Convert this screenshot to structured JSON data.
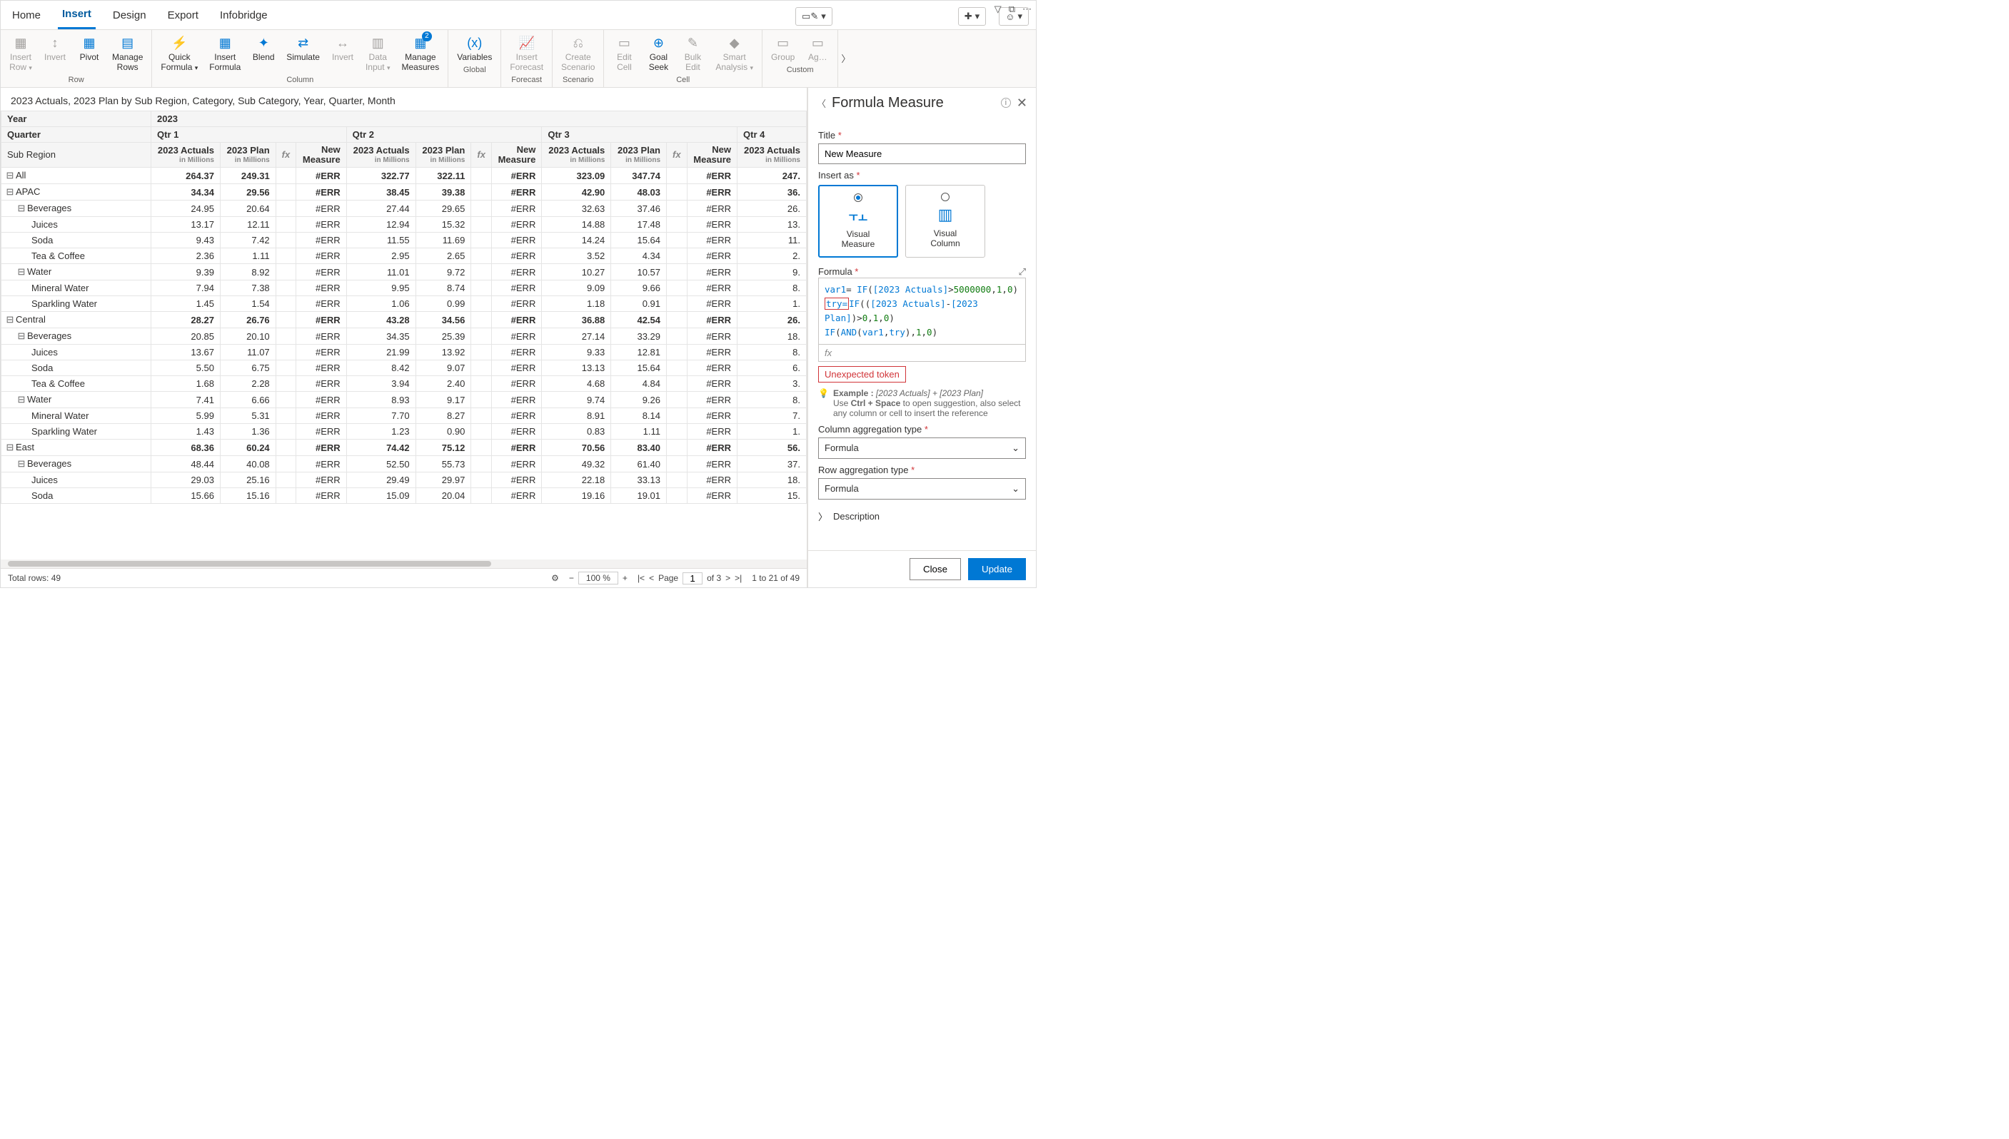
{
  "tabs": [
    "Home",
    "Insert",
    "Design",
    "Export",
    "Infobridge"
  ],
  "active_tab": 1,
  "ribbon": {
    "groups": [
      {
        "label": "Row",
        "buttons": [
          {
            "label": "Insert\nRow",
            "chev": true,
            "disabled": true,
            "icon": "▦"
          },
          {
            "label": "Invert",
            "disabled": true,
            "icon": "↕"
          },
          {
            "label": "Pivot",
            "icon": "▦"
          },
          {
            "label": "Manage\nRows",
            "icon": "▤"
          }
        ]
      },
      {
        "label": "Column",
        "buttons": [
          {
            "label": "Quick\nFormula",
            "chev": true,
            "icon": "⚡"
          },
          {
            "label": "Insert\nFormula",
            "icon": "▦"
          },
          {
            "label": "Blend",
            "icon": "✦"
          },
          {
            "label": "Simulate",
            "icon": "⇄"
          },
          {
            "label": "Invert",
            "disabled": true,
            "icon": "↔"
          },
          {
            "label": "Data\nInput",
            "chev": true,
            "disabled": true,
            "icon": "▥"
          },
          {
            "label": "Manage\nMeasures",
            "icon": "▦",
            "badge": "2"
          }
        ]
      },
      {
        "label": "Global",
        "buttons": [
          {
            "label": "Variables",
            "icon": "(x)"
          }
        ]
      },
      {
        "label": "Forecast",
        "buttons": [
          {
            "label": "Insert\nForecast",
            "disabled": true,
            "icon": "📈"
          }
        ]
      },
      {
        "label": "Scenario",
        "buttons": [
          {
            "label": "Create\nScenario",
            "disabled": true,
            "icon": "⎌"
          }
        ]
      },
      {
        "label": "Cell",
        "buttons": [
          {
            "label": "Edit\nCell",
            "disabled": true,
            "icon": "▭"
          },
          {
            "label": "Goal\nSeek",
            "icon": "⊕"
          },
          {
            "label": "Bulk\nEdit",
            "disabled": true,
            "icon": "✎"
          },
          {
            "label": "Smart\nAnalysis",
            "chev": true,
            "disabled": true,
            "icon": "◆"
          }
        ]
      },
      {
        "label": "Custom",
        "buttons": [
          {
            "label": "Group",
            "disabled": true,
            "icon": "▭"
          },
          {
            "label": "Ag…",
            "disabled": true,
            "icon": "▭"
          }
        ]
      }
    ]
  },
  "grid_title": "2023 Actuals, 2023 Plan by Sub Region, Category, Sub Category, Year, Quarter, Month",
  "dim_headers": {
    "year": "Year",
    "quarter": "Quarter",
    "subregion": "Sub Region"
  },
  "year_value": "2023",
  "quarters": [
    "Qtr 1",
    "Qtr 2",
    "Qtr 3",
    "Qtr 4"
  ],
  "col_set": [
    {
      "label": "2023 Actuals",
      "sub": "in Millions"
    },
    {
      "label": "2023 Plan",
      "sub": "in Millions"
    },
    {
      "fx": true
    },
    {
      "label": "New\nMeasure"
    }
  ],
  "rows": [
    {
      "l": "All",
      "d": 0,
      "b": true,
      "e": "-",
      "v": [
        "264.37",
        "249.31",
        "#ERR",
        "322.77",
        "322.11",
        "#ERR",
        "323.09",
        "347.74",
        "#ERR",
        "247."
      ]
    },
    {
      "l": "APAC",
      "d": 0,
      "b": true,
      "e": "-",
      "v": [
        "34.34",
        "29.56",
        "#ERR",
        "38.45",
        "39.38",
        "#ERR",
        "42.90",
        "48.03",
        "#ERR",
        "36."
      ]
    },
    {
      "l": "Beverages",
      "d": 1,
      "e": "-",
      "v": [
        "24.95",
        "20.64",
        "#ERR",
        "27.44",
        "29.65",
        "#ERR",
        "32.63",
        "37.46",
        "#ERR",
        "26."
      ]
    },
    {
      "l": "Juices",
      "d": 2,
      "v": [
        "13.17",
        "12.11",
        "#ERR",
        "12.94",
        "15.32",
        "#ERR",
        "14.88",
        "17.48",
        "#ERR",
        "13."
      ]
    },
    {
      "l": "Soda",
      "d": 2,
      "v": [
        "9.43",
        "7.42",
        "#ERR",
        "11.55",
        "11.69",
        "#ERR",
        "14.24",
        "15.64",
        "#ERR",
        "11."
      ]
    },
    {
      "l": "Tea & Coffee",
      "d": 2,
      "v": [
        "2.36",
        "1.11",
        "#ERR",
        "2.95",
        "2.65",
        "#ERR",
        "3.52",
        "4.34",
        "#ERR",
        "2."
      ]
    },
    {
      "l": "Water",
      "d": 1,
      "e": "-",
      "v": [
        "9.39",
        "8.92",
        "#ERR",
        "11.01",
        "9.72",
        "#ERR",
        "10.27",
        "10.57",
        "#ERR",
        "9."
      ]
    },
    {
      "l": "Mineral Water",
      "d": 2,
      "v": [
        "7.94",
        "7.38",
        "#ERR",
        "9.95",
        "8.74",
        "#ERR",
        "9.09",
        "9.66",
        "#ERR",
        "8."
      ]
    },
    {
      "l": "Sparkling Water",
      "d": 2,
      "v": [
        "1.45",
        "1.54",
        "#ERR",
        "1.06",
        "0.99",
        "#ERR",
        "1.18",
        "0.91",
        "#ERR",
        "1."
      ]
    },
    {
      "l": "Central",
      "d": 0,
      "b": true,
      "e": "-",
      "v": [
        "28.27",
        "26.76",
        "#ERR",
        "43.28",
        "34.56",
        "#ERR",
        "36.88",
        "42.54",
        "#ERR",
        "26."
      ]
    },
    {
      "l": "Beverages",
      "d": 1,
      "e": "-",
      "v": [
        "20.85",
        "20.10",
        "#ERR",
        "34.35",
        "25.39",
        "#ERR",
        "27.14",
        "33.29",
        "#ERR",
        "18."
      ]
    },
    {
      "l": "Juices",
      "d": 2,
      "v": [
        "13.67",
        "11.07",
        "#ERR",
        "21.99",
        "13.92",
        "#ERR",
        "9.33",
        "12.81",
        "#ERR",
        "8."
      ]
    },
    {
      "l": "Soda",
      "d": 2,
      "v": [
        "5.50",
        "6.75",
        "#ERR",
        "8.42",
        "9.07",
        "#ERR",
        "13.13",
        "15.64",
        "#ERR",
        "6."
      ]
    },
    {
      "l": "Tea & Coffee",
      "d": 2,
      "v": [
        "1.68",
        "2.28",
        "#ERR",
        "3.94",
        "2.40",
        "#ERR",
        "4.68",
        "4.84",
        "#ERR",
        "3."
      ]
    },
    {
      "l": "Water",
      "d": 1,
      "e": "-",
      "v": [
        "7.41",
        "6.66",
        "#ERR",
        "8.93",
        "9.17",
        "#ERR",
        "9.74",
        "9.26",
        "#ERR",
        "8."
      ]
    },
    {
      "l": "Mineral Water",
      "d": 2,
      "v": [
        "5.99",
        "5.31",
        "#ERR",
        "7.70",
        "8.27",
        "#ERR",
        "8.91",
        "8.14",
        "#ERR",
        "7."
      ]
    },
    {
      "l": "Sparkling Water",
      "d": 2,
      "v": [
        "1.43",
        "1.36",
        "#ERR",
        "1.23",
        "0.90",
        "#ERR",
        "0.83",
        "1.11",
        "#ERR",
        "1."
      ]
    },
    {
      "l": "East",
      "d": 0,
      "b": true,
      "e": "-",
      "v": [
        "68.36",
        "60.24",
        "#ERR",
        "74.42",
        "75.12",
        "#ERR",
        "70.56",
        "83.40",
        "#ERR",
        "56."
      ]
    },
    {
      "l": "Beverages",
      "d": 1,
      "e": "-",
      "v": [
        "48.44",
        "40.08",
        "#ERR",
        "52.50",
        "55.73",
        "#ERR",
        "49.32",
        "61.40",
        "#ERR",
        "37."
      ]
    },
    {
      "l": "Juices",
      "d": 2,
      "v": [
        "29.03",
        "25.16",
        "#ERR",
        "29.49",
        "29.97",
        "#ERR",
        "22.18",
        "33.13",
        "#ERR",
        "18."
      ]
    },
    {
      "l": "Soda",
      "d": 2,
      "v": [
        "15.66",
        "15.16",
        "#ERR",
        "15.09",
        "20.04",
        "#ERR",
        "19.16",
        "19.01",
        "#ERR",
        "15."
      ]
    }
  ],
  "footer": {
    "total_rows_label": "Total rows:",
    "total_rows": "49",
    "zoom": "100 %",
    "page_label": "Page",
    "page": "1",
    "of": "of 3",
    "range": "1  to  21  of  49"
  },
  "panel": {
    "title": "Formula Measure",
    "title_label": "Title",
    "title_value": "New Measure",
    "insert_as_label": "Insert as",
    "ias": [
      {
        "label": "Visual\nMeasure",
        "selected": true
      },
      {
        "label": "Visual\nColumn",
        "selected": false
      }
    ],
    "formula_label": "Formula",
    "formula_lines": [
      [
        {
          "t": "var1",
          "c": "var"
        },
        {
          "t": "= "
        },
        {
          "t": "IF",
          "c": "fn"
        },
        {
          "t": "("
        },
        {
          "t": "[2023 Actuals]",
          "c": "ref"
        },
        {
          "t": ">"
        },
        {
          "t": "5000000",
          "c": "num"
        },
        {
          "t": ","
        },
        {
          "t": "1",
          "c": "num"
        },
        {
          "t": ","
        },
        {
          "t": "0",
          "c": "num"
        },
        {
          "t": ")"
        }
      ],
      [
        {
          "t": "try=",
          "c": "err"
        },
        {
          "t": "IF",
          "c": "fn"
        },
        {
          "t": "(("
        },
        {
          "t": "[2023 Actuals]",
          "c": "ref"
        },
        {
          "t": "-"
        },
        {
          "t": "[2023 Plan]",
          "c": "ref"
        },
        {
          "t": ")>"
        },
        {
          "t": "0",
          "c": "num"
        },
        {
          "t": ","
        },
        {
          "t": "1",
          "c": "num"
        },
        {
          "t": ","
        },
        {
          "t": "0",
          "c": "num"
        },
        {
          "t": ")"
        }
      ],
      [
        {
          "t": "IF",
          "c": "fn"
        },
        {
          "t": "("
        },
        {
          "t": "AND",
          "c": "fn"
        },
        {
          "t": "("
        },
        {
          "t": "var1",
          "c": "var"
        },
        {
          "t": ","
        },
        {
          "t": "try",
          "c": "var"
        },
        {
          "t": "),"
        },
        {
          "t": "1",
          "c": "num"
        },
        {
          "t": ","
        },
        {
          "t": "0",
          "c": "num"
        },
        {
          "t": ")"
        }
      ]
    ],
    "fx_glyph": "fx",
    "error": "Unexpected token",
    "example_label": "Example :",
    "example": "[2023 Actuals] + [2023 Plan]",
    "hint1": "Use ",
    "hint_bold": "Ctrl + Space",
    "hint2": " to open suggestion, also select any column or cell to insert the reference",
    "col_agg_label": "Column aggregation type",
    "col_agg_value": "Formula",
    "row_agg_label": "Row aggregation type",
    "row_agg_value": "Formula",
    "desc_label": "Description",
    "close": "Close",
    "update": "Update"
  }
}
